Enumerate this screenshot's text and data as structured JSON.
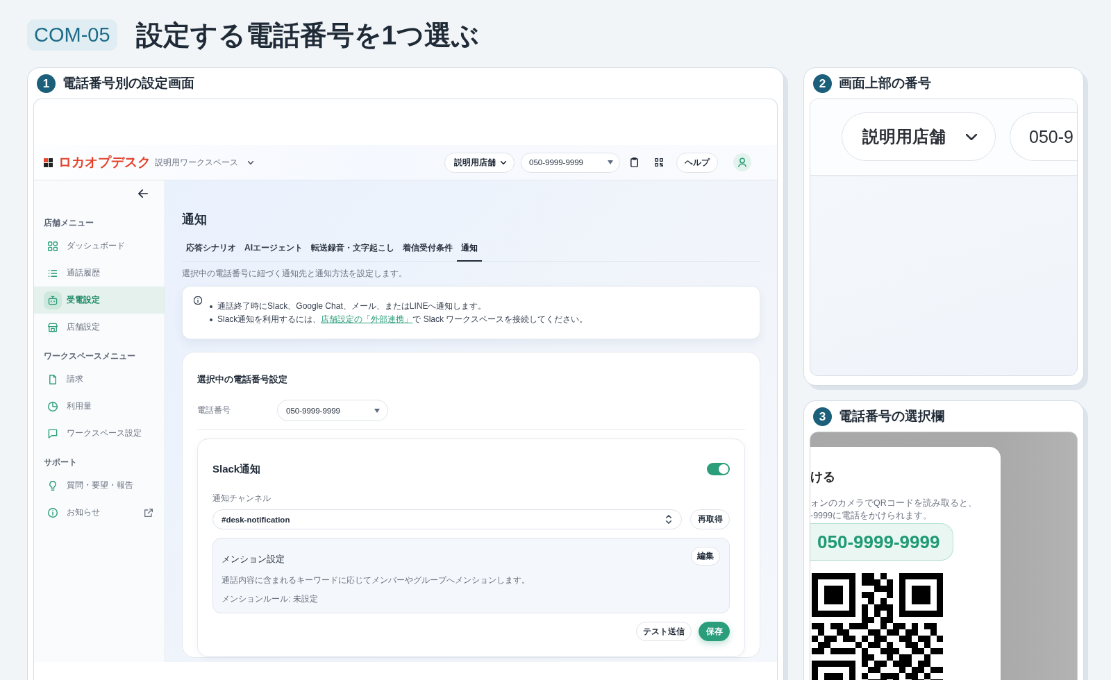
{
  "header": {
    "badge": "COM-05",
    "title": "設定する電話番号を1つ選ぶ"
  },
  "panels": [
    {
      "kind": "app",
      "number": "1",
      "title": "電話番号別の設定画面",
      "app": {
        "logo": "ロカオプデスク",
        "workspace": "説明用ワークスペース",
        "store_select": "説明用店舗",
        "phone_select": "050-9999-9999",
        "help_button": "ヘルプ",
        "sidebar": [
          {
            "label": "店舗メニュー",
            "items": [
              {
                "label": "ダッシュボード",
                "selected": false
              },
              {
                "label": "通話履歴",
                "selected": false
              },
              {
                "label": "受電設定",
                "selected": true
              },
              {
                "label": "店舗設定",
                "selected": false
              }
            ]
          },
          {
            "label": "ワークスペースメニュー",
            "items": [
              {
                "label": "請求",
                "selected": false
              },
              {
                "label": "利用量",
                "selected": false
              },
              {
                "label": "ワークスペース設定",
                "selected": false
              }
            ]
          },
          {
            "label": "サポート",
            "items": [
              {
                "label": "質問・要望・報告",
                "selected": false
              },
              {
                "label": "お知らせ",
                "selected": false
              }
            ]
          }
        ],
        "page_title": "通知",
        "tabs": [
          {
            "label": "応答シナリオ",
            "selected": false
          },
          {
            "label": "AIエージェント",
            "selected": false
          },
          {
            "label": "転送録音・文字起こし",
            "selected": false
          },
          {
            "label": "着信受付条件",
            "selected": false
          },
          {
            "label": "通知",
            "selected": true
          }
        ],
        "description": "選択中の電話番号に紐づく通知先と通知方法を設定します。",
        "info": [
          {
            "text": "通話終了時にSlack、Google Chat、メール、またはLINEへ通知します。"
          },
          {
            "text": "Slack通知を利用するには、",
            "link": "店舗設定の「外部連携」",
            "after": "で Slack ワークスペースを接続してください。"
          }
        ],
        "settings": {
          "title": "選択中の電話番号設定",
          "phone_label": "電話番号",
          "phone_value": "050-9999-9999",
          "slack": {
            "title": "Slack通知",
            "on": true,
            "channel_label": "通知チャンネル",
            "channel": "#desk-notification",
            "refresh_button": "再取得",
            "mention": {
              "title": "メンション設定",
              "edit_button": "編集",
              "description": "通話内容に含まれるキーワードに応じてメンバーやグループへメンションします。",
              "rule": "メンションルール: 未設定"
            },
            "test_button": "テスト送信",
            "save_button": "保存"
          }
        }
      }
    },
    {
      "kind": "header_zoom",
      "number": "2",
      "title": "画面上部の番号",
      "store_select": "説明用店舗",
      "phone_select": "050-9"
    },
    {
      "kind": "modal_zoom",
      "number": "3",
      "title": "電話番号の選択欄",
      "heading": "ける",
      "lines": [
        "ォンのカメラでQRコードを読み取ると、",
        "-9999に電話をかけられます。"
      ],
      "phone": "050-9999-9999"
    }
  ]
}
